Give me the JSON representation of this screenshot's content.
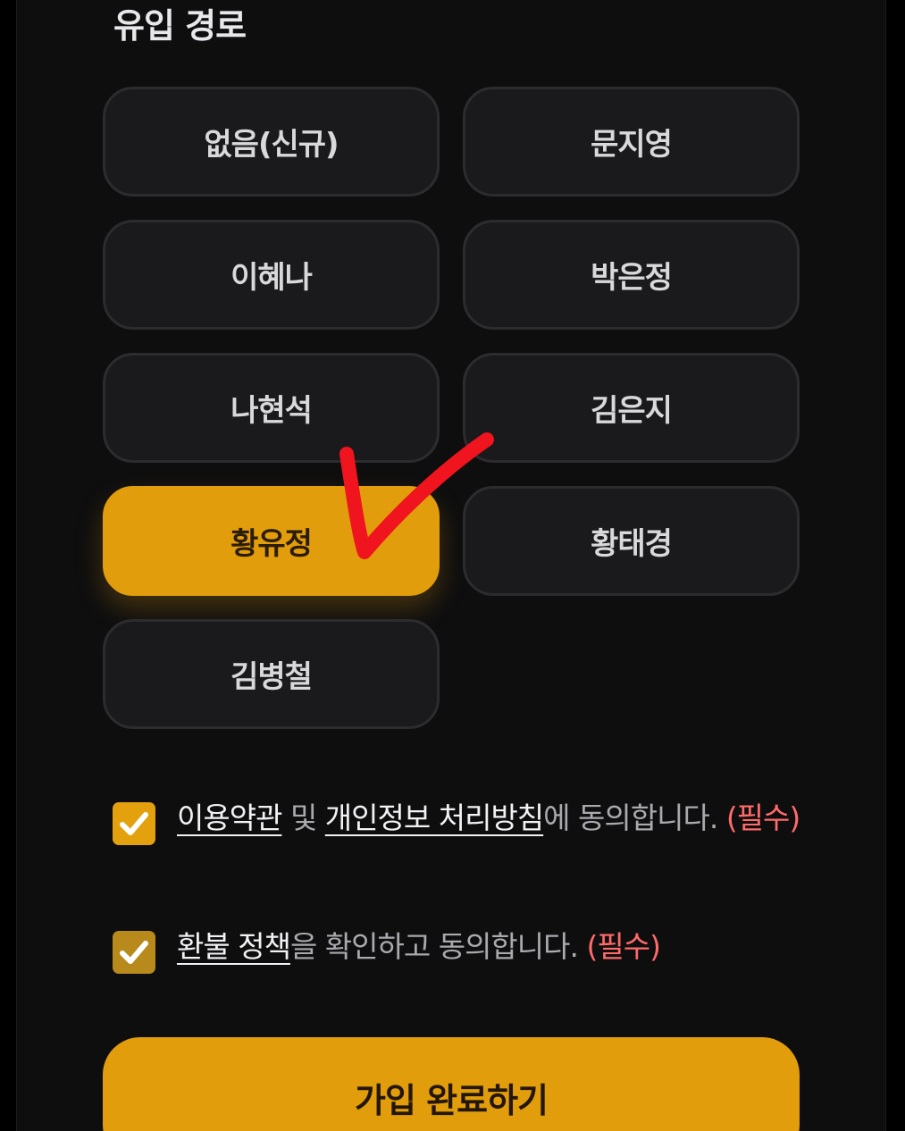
{
  "referral": {
    "title": "유입 경로",
    "options": [
      {
        "label": "없음(신규)",
        "selected": false
      },
      {
        "label": "문지영",
        "selected": false
      },
      {
        "label": "이혜나",
        "selected": false
      },
      {
        "label": "박은정",
        "selected": false
      },
      {
        "label": "나현석",
        "selected": false
      },
      {
        "label": "김은지",
        "selected": false
      },
      {
        "label": "황유정",
        "selected": true
      },
      {
        "label": "황태경",
        "selected": false
      },
      {
        "label": "김병철",
        "selected": false
      }
    ]
  },
  "agreements": {
    "terms": {
      "checked": true,
      "link1": "이용약관",
      "joiner": " 및 ",
      "link2": "개인정보 처리방침",
      "suffix": "에 동의합니다. ",
      "required": "(필수)"
    },
    "refund": {
      "checked": true,
      "link": "환불 정책",
      "suffix": "을 확인하고 동의합니다. ",
      "required": "(필수)"
    }
  },
  "submit_label": "가입 완료하기",
  "colors": {
    "accent": "#e29d0c",
    "option_bg": "#1a1a1c",
    "required": "#ff6a6a",
    "annotation": "#f0141e"
  }
}
